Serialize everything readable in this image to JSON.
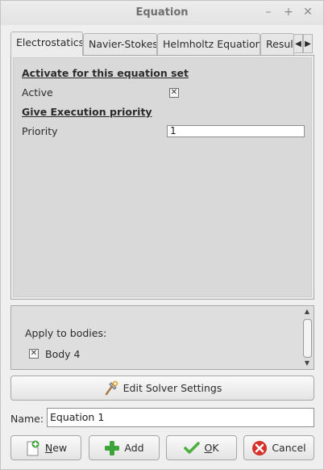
{
  "window": {
    "title": "Equation",
    "minimize_label": "–",
    "maximize_label": "+",
    "close_label": "✕"
  },
  "tabs": [
    {
      "label": "Electrostatics",
      "active": true
    },
    {
      "label": "Navier-Stokes",
      "active": false
    },
    {
      "label": "Helmholtz Equation",
      "active": false
    },
    {
      "label": "Resul",
      "active": false
    }
  ],
  "tab_scroll": {
    "left": "◀",
    "right": "▶"
  },
  "panel": {
    "section1_heading": "Activate for this equation set",
    "active_label": "Active",
    "active_checked": true,
    "section2_heading": "Give Execution priority",
    "priority_label": "Priority",
    "priority_value": "1"
  },
  "bodies": {
    "heading": "Apply to bodies:",
    "items": [
      {
        "label": "Body 4",
        "checked": true
      }
    ]
  },
  "solver_button": {
    "label": "Edit Solver Settings"
  },
  "name_field": {
    "label": "Name:",
    "value": "Equation 1"
  },
  "buttons": {
    "new_label_prefix": "N",
    "new_label_rest": "ew",
    "add_label": "Add",
    "ok_label_prefix": "O",
    "ok_label_rest": "K",
    "cancel_label": "Cancel"
  },
  "check_glyph": "✕",
  "colors": {
    "add_green": "#3ea33a",
    "ok_green": "#4caf3c",
    "cancel_red": "#d7312b"
  }
}
